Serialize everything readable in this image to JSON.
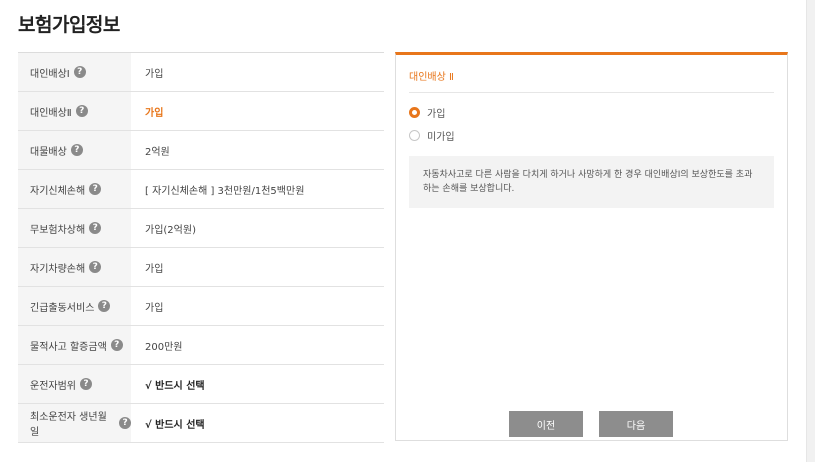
{
  "page": {
    "title": "보험가입정보"
  },
  "table": {
    "rows": [
      {
        "label": "대인배상Ⅰ",
        "value": "가입",
        "style": "normal"
      },
      {
        "label": "대인배상Ⅱ",
        "value": "가입",
        "style": "orange"
      },
      {
        "label": "대물배상",
        "value": "2억원",
        "style": "normal"
      },
      {
        "label": "자기신체손해",
        "value": "[ 자기신체손해 ] 3천만원/1천5백만원",
        "style": "normal"
      },
      {
        "label": "무보험차상해",
        "value": "가입(2억원)",
        "style": "normal"
      },
      {
        "label": "자기차량손해",
        "value": "가입",
        "style": "normal"
      },
      {
        "label": "긴급출동서비스",
        "value": "가입",
        "style": "normal"
      },
      {
        "label": "물적사고 할증금액",
        "value": "200만원",
        "style": "normal"
      },
      {
        "label": "운전자범위",
        "value": "√ 반드시 선택",
        "style": "bold"
      },
      {
        "label": "최소운전자 생년월일",
        "value": "√ 반드시 선택",
        "style": "bold"
      }
    ],
    "help_icon": "question-circle-icon",
    "help_glyph": "?"
  },
  "panel": {
    "title": "대인배상 Ⅱ",
    "options": [
      {
        "label": "가입",
        "selected": true
      },
      {
        "label": "미가입",
        "selected": false
      }
    ],
    "description": "자동차사고로 다른 사람을 다치게 하거나 사망하게 한 경우 대인배상Ⅰ의 보상한도를 초과하는 손해를 보상합니다.",
    "prev_label": "이전",
    "next_label": "다음"
  },
  "colors": {
    "accent": "#e8761b",
    "button": "#8d8d8d",
    "label_bg": "#f5f5f5"
  }
}
